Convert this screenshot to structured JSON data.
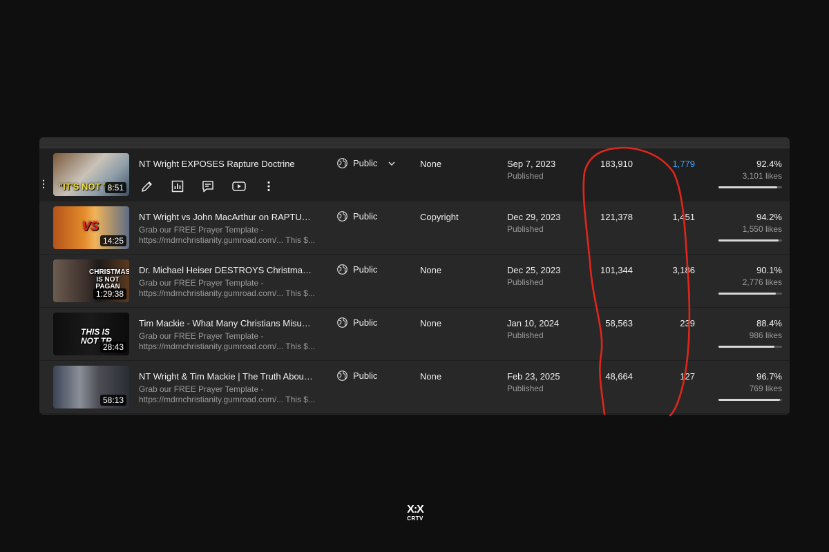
{
  "videos": [
    {
      "title": "NT Wright EXPOSES Rapture Doctrine",
      "duration": "8:51",
      "thumb_text": "\"IT'S NOT TR",
      "desc1": "",
      "desc2": "",
      "visibility": "Public",
      "restrictions": "None",
      "date": "Sep 7, 2023",
      "status": "Published",
      "views": "183,910",
      "comments": "1,779",
      "like_pct": "92.4%",
      "likes": "3,101 likes",
      "like_ratio": 0.924
    },
    {
      "title": "NT Wright vs John MacArthur on RAPTURE D...",
      "duration": "14:25",
      "thumb_text": "VS",
      "desc1": "Grab our FREE Prayer Template -",
      "desc2": "https://mdrnchristianity.gumroad.com/... This $...",
      "visibility": "Public",
      "restrictions": "Copyright",
      "date": "Dec 29, 2023",
      "status": "Published",
      "views": "121,378",
      "comments": "1,451",
      "like_pct": "94.2%",
      "likes": "1,550 likes",
      "like_ratio": 0.942
    },
    {
      "title": "Dr. Michael Heiser DESTROYS Christmas Pag...",
      "duration": "1:29:38",
      "thumb_text": "CHRISTMAS IS NOT PAGAN",
      "desc1": "Grab our FREE Prayer Template -",
      "desc2": "https://mdrnchristianity.gumroad.com/... This $...",
      "visibility": "Public",
      "restrictions": "None",
      "date": "Dec 25, 2023",
      "status": "Published",
      "views": "101,344",
      "comments": "3,186",
      "like_pct": "90.1%",
      "likes": "2,776 likes",
      "like_ratio": 0.901
    },
    {
      "title": "Tim Mackie - What Many Christians Misunder...",
      "duration": "28:43",
      "thumb_text": "THIS IS NOT TR",
      "desc1": "Grab our FREE Prayer Template -",
      "desc2": "https://mdrnchristianity.gumroad.com/... This $...",
      "visibility": "Public",
      "restrictions": "None",
      "date": "Jan 10, 2024",
      "status": "Published",
      "views": "58,563",
      "comments": "239",
      "like_pct": "88.4%",
      "likes": "986 likes",
      "like_ratio": 0.884
    },
    {
      "title": "NT Wright & Tim Mackie | The Truth About the...",
      "duration": "58:13",
      "thumb_text": "",
      "desc1": "Grab our FREE Prayer Template -",
      "desc2": "https://mdrnchristianity.gumroad.com/... This $...",
      "visibility": "Public",
      "restrictions": "None",
      "date": "Feb 23, 2025",
      "status": "Published",
      "views": "48,664",
      "comments": "127",
      "like_pct": "96.7%",
      "likes": "769 likes",
      "like_ratio": 0.967
    }
  ],
  "hover_actions": [
    "pencil-icon",
    "analytics-icon",
    "comments-icon",
    "youtube-icon",
    "more-vert-icon"
  ],
  "icons": {
    "visibility": "globe-icon",
    "dropdown": "chevron-down-icon",
    "drag": "drag-handle-icon"
  },
  "colors": {
    "link": "#3ea6ff",
    "annotation": "#e0261b",
    "panel": "#282828"
  },
  "logo": {
    "line1": "X:X",
    "line2": "CRTV"
  }
}
